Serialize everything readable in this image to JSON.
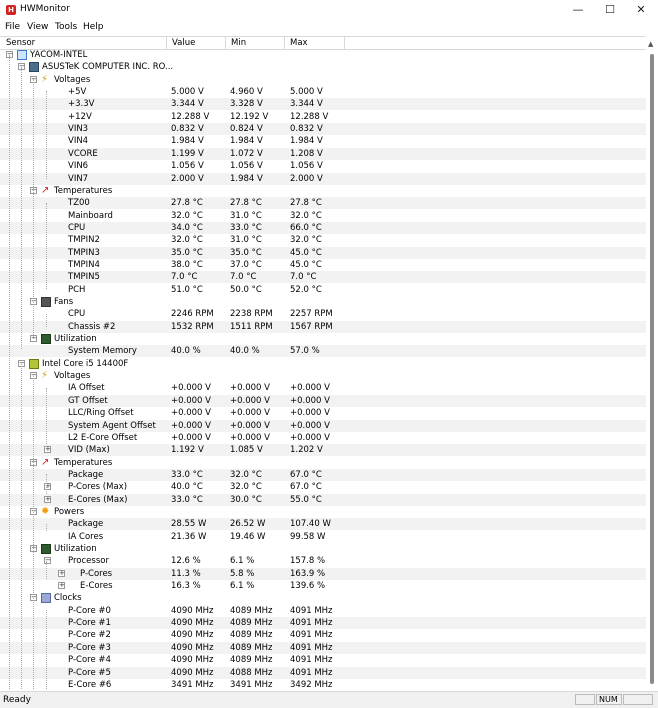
{
  "window": {
    "title": "HWMonitor",
    "minimize": "—",
    "maximize": "☐",
    "close": "✕"
  },
  "menu": [
    "File",
    "View",
    "Tools",
    "Help"
  ],
  "columns": [
    "Sensor",
    "Value",
    "Min",
    "Max"
  ],
  "tree": [
    {
      "level": 0,
      "kind": "root",
      "icon": "computer-icon",
      "label": "YACOM-INTEL",
      "exp": "-"
    },
    {
      "level": 1,
      "kind": "node",
      "icon": "motherboard-icon",
      "label": "ASUSTeK COMPUTER INC. RO...",
      "exp": "-"
    },
    {
      "level": 2,
      "kind": "group",
      "icon": "voltage-icon",
      "label": "Voltages",
      "exp": "-"
    },
    {
      "level": 3,
      "label": "+5V",
      "value": "5.000 V",
      "min": "4.960 V",
      "max": "5.000 V"
    },
    {
      "level": 3,
      "label": "+3.3V",
      "value": "3.344 V",
      "min": "3.328 V",
      "max": "3.344 V"
    },
    {
      "level": 3,
      "label": "+12V",
      "value": "12.288 V",
      "min": "12.192 V",
      "max": "12.288 V"
    },
    {
      "level": 3,
      "label": "VIN3",
      "value": "0.832 V",
      "min": "0.824 V",
      "max": "0.832 V"
    },
    {
      "level": 3,
      "label": "VIN4",
      "value": "1.984 V",
      "min": "1.984 V",
      "max": "1.984 V"
    },
    {
      "level": 3,
      "label": "VCORE",
      "value": "1.199 V",
      "min": "1.072 V",
      "max": "1.208 V"
    },
    {
      "level": 3,
      "label": "VIN6",
      "value": "1.056 V",
      "min": "1.056 V",
      "max": "1.056 V"
    },
    {
      "level": 3,
      "label": "VIN7",
      "value": "2.000 V",
      "min": "1.984 V",
      "max": "2.000 V"
    },
    {
      "level": 2,
      "kind": "group",
      "icon": "thermometer-icon",
      "label": "Temperatures",
      "exp": "-"
    },
    {
      "level": 3,
      "label": "TZ00",
      "value": "27.8 °C",
      "min": "27.8 °C",
      "max": "27.8 °C"
    },
    {
      "level": 3,
      "label": "Mainboard",
      "value": "32.0 °C",
      "min": "31.0 °C",
      "max": "32.0 °C"
    },
    {
      "level": 3,
      "label": "CPU",
      "value": "34.0 °C",
      "min": "33.0 °C",
      "max": "66.0 °C"
    },
    {
      "level": 3,
      "label": "TMPIN2",
      "value": "32.0 °C",
      "min": "31.0 °C",
      "max": "32.0 °C"
    },
    {
      "level": 3,
      "label": "TMPIN3",
      "value": "35.0 °C",
      "min": "35.0 °C",
      "max": "45.0 °C"
    },
    {
      "level": 3,
      "label": "TMPIN4",
      "value": "38.0 °C",
      "min": "37.0 °C",
      "max": "45.0 °C"
    },
    {
      "level": 3,
      "label": "TMPIN5",
      "value": "7.0 °C",
      "min": "7.0 °C",
      "max": "7.0 °C"
    },
    {
      "level": 3,
      "label": "PCH",
      "value": "51.0 °C",
      "min": "50.0 °C",
      "max": "52.0 °C"
    },
    {
      "level": 2,
      "kind": "group",
      "icon": "fan-icon",
      "label": "Fans",
      "exp": "-"
    },
    {
      "level": 3,
      "label": "CPU",
      "value": "2246 RPM",
      "min": "2238 RPM",
      "max": "2257 RPM"
    },
    {
      "level": 3,
      "label": "Chassis #2",
      "value": "1532 RPM",
      "min": "1511 RPM",
      "max": "1567 RPM"
    },
    {
      "level": 2,
      "kind": "group",
      "icon": "utilization-icon",
      "label": "Utilization",
      "exp": "-"
    },
    {
      "level": 3,
      "label": "System Memory",
      "value": "40.0 %",
      "min": "40.0 %",
      "max": "57.0 %"
    },
    {
      "level": 1,
      "kind": "node",
      "icon": "cpu-icon",
      "label": "Intel Core i5 14400F",
      "exp": "-"
    },
    {
      "level": 2,
      "kind": "group",
      "icon": "voltage-icon",
      "label": "Voltages",
      "exp": "-"
    },
    {
      "level": 3,
      "label": "IA Offset",
      "value": "+0.000 V",
      "min": "+0.000 V",
      "max": "+0.000 V"
    },
    {
      "level": 3,
      "label": "GT Offset",
      "value": "+0.000 V",
      "min": "+0.000 V",
      "max": "+0.000 V"
    },
    {
      "level": 3,
      "label": "LLC/Ring Offset",
      "value": "+0.000 V",
      "min": "+0.000 V",
      "max": "+0.000 V"
    },
    {
      "level": 3,
      "label": "System Agent Offset",
      "value": "+0.000 V",
      "min": "+0.000 V",
      "max": "+0.000 V"
    },
    {
      "level": 3,
      "label": "L2 E-Core Offset",
      "value": "+0.000 V",
      "min": "+0.000 V",
      "max": "+0.000 V"
    },
    {
      "level": 3,
      "label": "VID (Max)",
      "value": "1.192 V",
      "min": "1.085 V",
      "max": "1.202 V",
      "exp": "+"
    },
    {
      "level": 2,
      "kind": "group",
      "icon": "thermometer-icon",
      "label": "Temperatures",
      "exp": "-"
    },
    {
      "level": 3,
      "label": "Package",
      "value": "33.0 °C",
      "min": "32.0 °C",
      "max": "67.0 °C"
    },
    {
      "level": 3,
      "label": "P-Cores (Max)",
      "value": "40.0 °C",
      "min": "32.0 °C",
      "max": "67.0 °C",
      "exp": "+"
    },
    {
      "level": 3,
      "label": "E-Cores (Max)",
      "value": "33.0 °C",
      "min": "30.0 °C",
      "max": "55.0 °C",
      "exp": "+"
    },
    {
      "level": 2,
      "kind": "group",
      "icon": "power-icon",
      "label": "Powers",
      "exp": "-"
    },
    {
      "level": 3,
      "label": "Package",
      "value": "28.55 W",
      "min": "26.52 W",
      "max": "107.40 W"
    },
    {
      "level": 3,
      "label": "IA Cores",
      "value": "21.36 W",
      "min": "19.46 W",
      "max": "99.58 W"
    },
    {
      "level": 2,
      "kind": "group",
      "icon": "utilization-icon",
      "label": "Utilization",
      "exp": "-"
    },
    {
      "level": 3,
      "label": "Processor",
      "value": "12.6 %",
      "min": "6.1 %",
      "max": "157.8 %",
      "exp": "-"
    },
    {
      "level": 4,
      "label": "P-Cores",
      "value": "11.3 %",
      "min": "5.8 %",
      "max": "163.9 %",
      "exp": "+"
    },
    {
      "level": 4,
      "label": "E-Cores",
      "value": "16.3 %",
      "min": "6.1 %",
      "max": "139.6 %",
      "exp": "+"
    },
    {
      "level": 2,
      "kind": "group",
      "icon": "clock-icon",
      "label": "Clocks",
      "exp": "-"
    },
    {
      "level": 3,
      "label": "P-Core #0",
      "value": "4090 MHz",
      "min": "4089 MHz",
      "max": "4091 MHz"
    },
    {
      "level": 3,
      "label": "P-Core #1",
      "value": "4090 MHz",
      "min": "4089 MHz",
      "max": "4091 MHz"
    },
    {
      "level": 3,
      "label": "P-Core #2",
      "value": "4090 MHz",
      "min": "4089 MHz",
      "max": "4091 MHz"
    },
    {
      "level": 3,
      "label": "P-Core #3",
      "value": "4090 MHz",
      "min": "4089 MHz",
      "max": "4091 MHz"
    },
    {
      "level": 3,
      "label": "P-Core #4",
      "value": "4090 MHz",
      "min": "4089 MHz",
      "max": "4091 MHz"
    },
    {
      "level": 3,
      "label": "P-Core #5",
      "value": "4090 MHz",
      "min": "4088 MHz",
      "max": "4091 MHz"
    },
    {
      "level": 3,
      "label": "E-Core #6",
      "value": "3491 MHz",
      "min": "3491 MHz",
      "max": "3492 MHz"
    }
  ],
  "status": {
    "text": "Ready",
    "num": "NUM"
  }
}
